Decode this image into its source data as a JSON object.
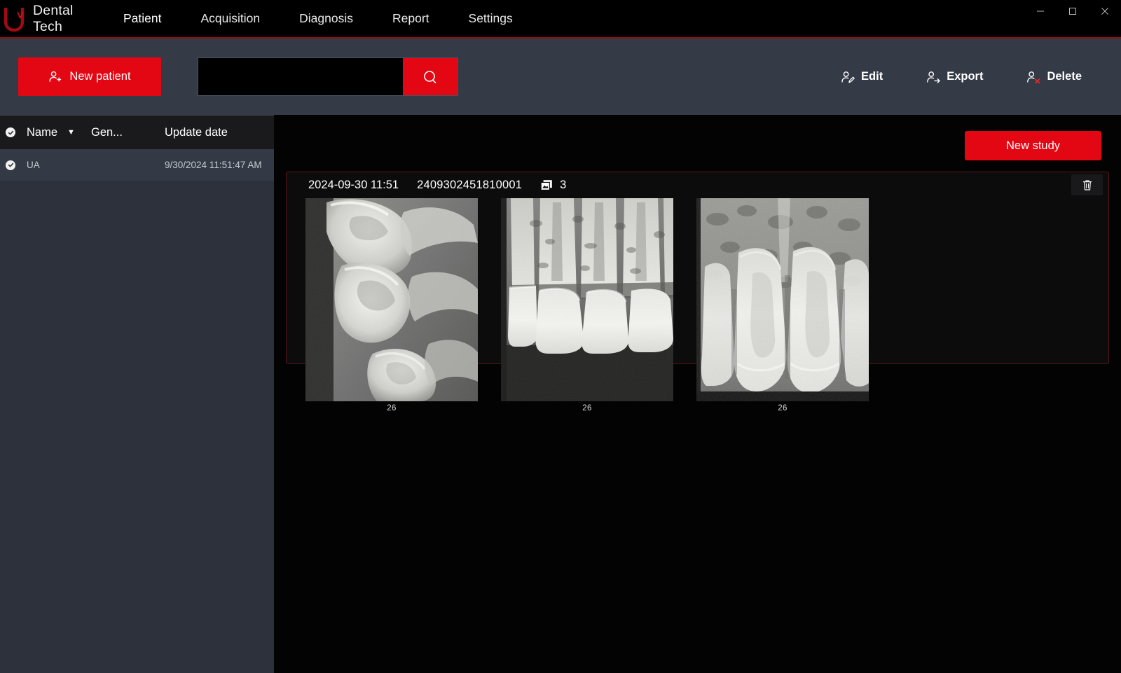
{
  "app": {
    "brand_name": "Dental Tech",
    "logo_icon": "u-a-monogram-logo",
    "accent_color": "#e30613",
    "toolbar_bg": "#343a46"
  },
  "window_controls": {
    "minimize": "minimize-icon",
    "maximize": "maximize-icon",
    "close": "close-icon"
  },
  "nav": {
    "tabs": [
      {
        "label": "Patient",
        "active": true
      },
      {
        "label": "Acquisition",
        "active": false
      },
      {
        "label": "Diagnosis",
        "active": false
      },
      {
        "label": "Report",
        "active": false
      },
      {
        "label": "Settings",
        "active": false
      }
    ]
  },
  "toolbar": {
    "new_patient_label": "New patient",
    "new_patient_icon": "user-add-icon",
    "search_value": "",
    "search_placeholder": "",
    "search_icon": "search-icon",
    "actions": [
      {
        "label": "Edit",
        "icon": "user-edit-icon"
      },
      {
        "label": "Export",
        "icon": "user-export-icon"
      },
      {
        "label": "Delete",
        "icon": "user-delete-icon"
      }
    ]
  },
  "patient_list": {
    "columns": [
      {
        "key": "check",
        "label": ""
      },
      {
        "key": "name",
        "label": "Name"
      },
      {
        "key": "gender",
        "label": "Gen..."
      },
      {
        "key": "update_date",
        "label": "Update date"
      }
    ],
    "sort_caret": "▼",
    "header_check_icon": "check-circle-icon",
    "rows": [
      {
        "check_icon": "check-circle-icon",
        "name": "UA",
        "gender": "",
        "update_date": "9/30/2024 11:51:47 AM",
        "selected": true
      }
    ]
  },
  "main": {
    "new_study_label": "New study",
    "studies": [
      {
        "date": "2024-09-30 11:51",
        "id": "2409302451810001",
        "count": "3",
        "count_icon": "image-stack-icon",
        "delete_icon": "trash-icon",
        "images": [
          {
            "label": "26",
            "alt": "posterior-molar-bitewing-radiograph"
          },
          {
            "label": "26",
            "alt": "anterior-incisor-periapical-radiograph"
          },
          {
            "label": "26",
            "alt": "maxillary-central-incisor-periapical-radiograph"
          }
        ]
      }
    ]
  }
}
